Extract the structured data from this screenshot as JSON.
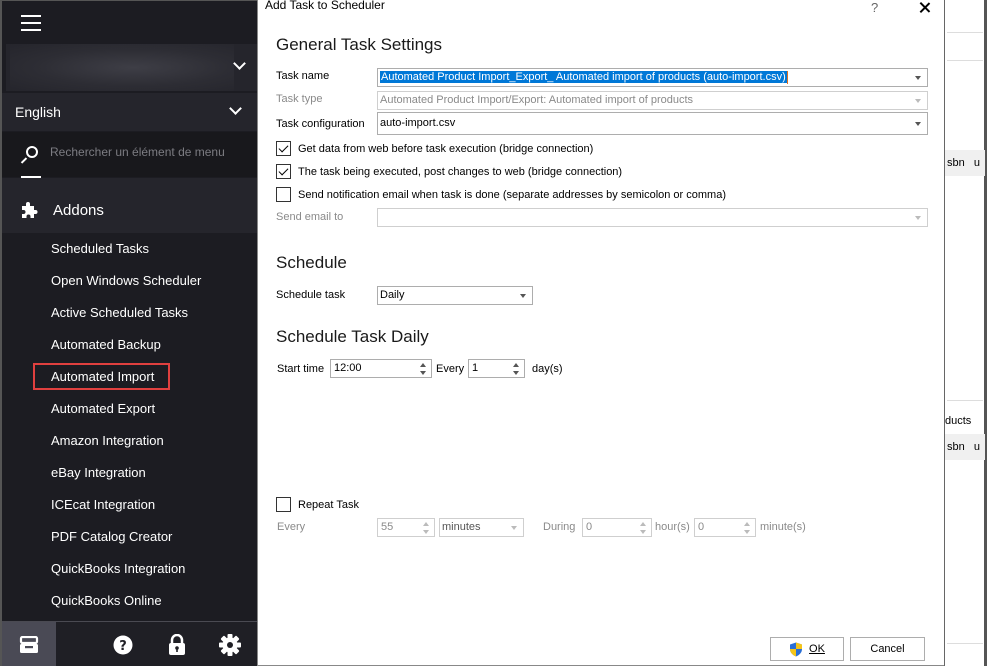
{
  "sidebar": {
    "menu_icon": "hamburger-icon",
    "account": {
      "value_obscured": true,
      "chevron_icon": "chevron-down-icon"
    },
    "language": {
      "label": "English",
      "chevron_icon": "chevron-down-icon"
    },
    "search": {
      "placeholder": "Rechercher un élément de menu",
      "icon": "search-icon"
    },
    "section": {
      "label": "Addons",
      "icon": "puzzle-icon"
    },
    "items": [
      {
        "label": "Scheduled Tasks"
      },
      {
        "label": "Open Windows Scheduler"
      },
      {
        "label": "Active Scheduled Tasks"
      },
      {
        "label": "Automated Backup"
      },
      {
        "label": "Automated Import",
        "highlighted": true
      },
      {
        "label": "Automated Export"
      },
      {
        "label": "Amazon Integration"
      },
      {
        "label": "eBay Integration"
      },
      {
        "label": "ICEcat Integration"
      },
      {
        "label": "PDF Catalog Creator"
      },
      {
        "label": "QuickBooks Integration"
      },
      {
        "label": "QuickBooks Online"
      }
    ],
    "bottom_bar": [
      {
        "icon": "archive-icon",
        "active": true
      },
      {
        "icon": "help-icon"
      },
      {
        "icon": "lock-icon"
      },
      {
        "icon": "gear-icon"
      }
    ],
    "highlight_color": "#e0403f"
  },
  "dialog": {
    "title": "Add Task to Scheduler",
    "help_label": "?",
    "general": {
      "heading": "General Task Settings",
      "task_name_label": "Task name",
      "task_name_value": "Automated Product Import_Export_ Automated import of products (auto-import.csv)",
      "task_type_label": "Task type",
      "task_type_value": "Automated Product Import/Export: Automated import of products",
      "task_config_label": "Task configuration",
      "task_config_value": "auto-import.csv",
      "checkboxes": [
        {
          "label": "Get data from web before task execution (bridge connection)",
          "checked": true
        },
        {
          "label": "The task being executed, post changes to web (bridge connection)",
          "checked": true
        },
        {
          "label": "Send notification email when task is done (separate addresses by semicolon or comma)",
          "checked": false
        }
      ],
      "send_email_label": "Send email to",
      "send_email_value": ""
    },
    "schedule": {
      "heading": "Schedule",
      "schedule_task_label": "Schedule task",
      "schedule_task_value": "Daily"
    },
    "daily": {
      "heading": "Schedule Task Daily",
      "start_time_label": "Start time",
      "start_time_value": "12:00",
      "every_label": "Every",
      "every_value": "1",
      "unit_label": "day(s)"
    },
    "repeat": {
      "checkbox_label": "Repeat Task",
      "checked": false,
      "every_label": "Every",
      "every_value": "55",
      "unit_value": "minutes",
      "during_label": "During",
      "hours_value": "0",
      "hours_label": "hour(s)",
      "minutes_value": "0",
      "minutes_label": "minute(s)"
    },
    "buttons": {
      "ok_label": "OK",
      "ok_icon": "uac-shield-icon",
      "cancel_label": "Cancel"
    },
    "selection_color": "#0078d7"
  },
  "background": {
    "grid_headers": [
      "sbn",
      "u"
    ],
    "panel_title_fragment": "ducts"
  }
}
